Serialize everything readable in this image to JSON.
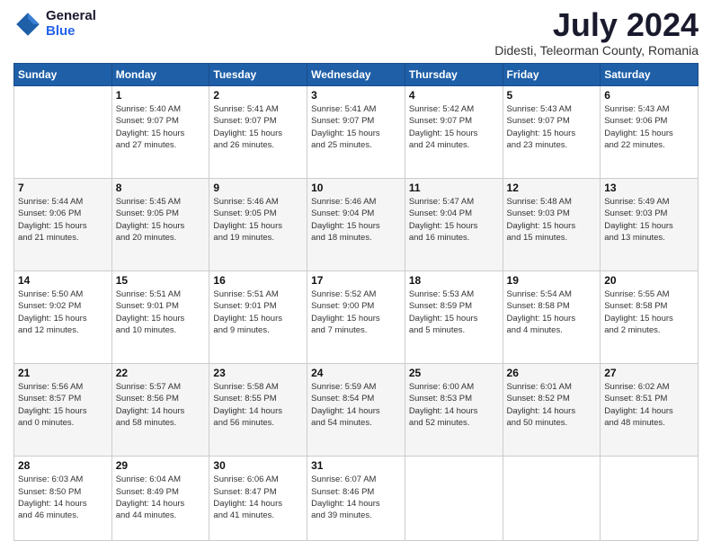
{
  "logo": {
    "general": "General",
    "blue": "Blue"
  },
  "title": "July 2024",
  "location": "Didesti, Teleorman County, Romania",
  "weekdays": [
    "Sunday",
    "Monday",
    "Tuesday",
    "Wednesday",
    "Thursday",
    "Friday",
    "Saturday"
  ],
  "weeks": [
    [
      {
        "day": "",
        "info": ""
      },
      {
        "day": "1",
        "info": "Sunrise: 5:40 AM\nSunset: 9:07 PM\nDaylight: 15 hours\nand 27 minutes."
      },
      {
        "day": "2",
        "info": "Sunrise: 5:41 AM\nSunset: 9:07 PM\nDaylight: 15 hours\nand 26 minutes."
      },
      {
        "day": "3",
        "info": "Sunrise: 5:41 AM\nSunset: 9:07 PM\nDaylight: 15 hours\nand 25 minutes."
      },
      {
        "day": "4",
        "info": "Sunrise: 5:42 AM\nSunset: 9:07 PM\nDaylight: 15 hours\nand 24 minutes."
      },
      {
        "day": "5",
        "info": "Sunrise: 5:43 AM\nSunset: 9:07 PM\nDaylight: 15 hours\nand 23 minutes."
      },
      {
        "day": "6",
        "info": "Sunrise: 5:43 AM\nSunset: 9:06 PM\nDaylight: 15 hours\nand 22 minutes."
      }
    ],
    [
      {
        "day": "7",
        "info": "Sunrise: 5:44 AM\nSunset: 9:06 PM\nDaylight: 15 hours\nand 21 minutes."
      },
      {
        "day": "8",
        "info": "Sunrise: 5:45 AM\nSunset: 9:05 PM\nDaylight: 15 hours\nand 20 minutes."
      },
      {
        "day": "9",
        "info": "Sunrise: 5:46 AM\nSunset: 9:05 PM\nDaylight: 15 hours\nand 19 minutes."
      },
      {
        "day": "10",
        "info": "Sunrise: 5:46 AM\nSunset: 9:04 PM\nDaylight: 15 hours\nand 18 minutes."
      },
      {
        "day": "11",
        "info": "Sunrise: 5:47 AM\nSunset: 9:04 PM\nDaylight: 15 hours\nand 16 minutes."
      },
      {
        "day": "12",
        "info": "Sunrise: 5:48 AM\nSunset: 9:03 PM\nDaylight: 15 hours\nand 15 minutes."
      },
      {
        "day": "13",
        "info": "Sunrise: 5:49 AM\nSunset: 9:03 PM\nDaylight: 15 hours\nand 13 minutes."
      }
    ],
    [
      {
        "day": "14",
        "info": "Sunrise: 5:50 AM\nSunset: 9:02 PM\nDaylight: 15 hours\nand 12 minutes."
      },
      {
        "day": "15",
        "info": "Sunrise: 5:51 AM\nSunset: 9:01 PM\nDaylight: 15 hours\nand 10 minutes."
      },
      {
        "day": "16",
        "info": "Sunrise: 5:51 AM\nSunset: 9:01 PM\nDaylight: 15 hours\nand 9 minutes."
      },
      {
        "day": "17",
        "info": "Sunrise: 5:52 AM\nSunset: 9:00 PM\nDaylight: 15 hours\nand 7 minutes."
      },
      {
        "day": "18",
        "info": "Sunrise: 5:53 AM\nSunset: 8:59 PM\nDaylight: 15 hours\nand 5 minutes."
      },
      {
        "day": "19",
        "info": "Sunrise: 5:54 AM\nSunset: 8:58 PM\nDaylight: 15 hours\nand 4 minutes."
      },
      {
        "day": "20",
        "info": "Sunrise: 5:55 AM\nSunset: 8:58 PM\nDaylight: 15 hours\nand 2 minutes."
      }
    ],
    [
      {
        "day": "21",
        "info": "Sunrise: 5:56 AM\nSunset: 8:57 PM\nDaylight: 15 hours\nand 0 minutes."
      },
      {
        "day": "22",
        "info": "Sunrise: 5:57 AM\nSunset: 8:56 PM\nDaylight: 14 hours\nand 58 minutes."
      },
      {
        "day": "23",
        "info": "Sunrise: 5:58 AM\nSunset: 8:55 PM\nDaylight: 14 hours\nand 56 minutes."
      },
      {
        "day": "24",
        "info": "Sunrise: 5:59 AM\nSunset: 8:54 PM\nDaylight: 14 hours\nand 54 minutes."
      },
      {
        "day": "25",
        "info": "Sunrise: 6:00 AM\nSunset: 8:53 PM\nDaylight: 14 hours\nand 52 minutes."
      },
      {
        "day": "26",
        "info": "Sunrise: 6:01 AM\nSunset: 8:52 PM\nDaylight: 14 hours\nand 50 minutes."
      },
      {
        "day": "27",
        "info": "Sunrise: 6:02 AM\nSunset: 8:51 PM\nDaylight: 14 hours\nand 48 minutes."
      }
    ],
    [
      {
        "day": "28",
        "info": "Sunrise: 6:03 AM\nSunset: 8:50 PM\nDaylight: 14 hours\nand 46 minutes."
      },
      {
        "day": "29",
        "info": "Sunrise: 6:04 AM\nSunset: 8:49 PM\nDaylight: 14 hours\nand 44 minutes."
      },
      {
        "day": "30",
        "info": "Sunrise: 6:06 AM\nSunset: 8:47 PM\nDaylight: 14 hours\nand 41 minutes."
      },
      {
        "day": "31",
        "info": "Sunrise: 6:07 AM\nSunset: 8:46 PM\nDaylight: 14 hours\nand 39 minutes."
      },
      {
        "day": "",
        "info": ""
      },
      {
        "day": "",
        "info": ""
      },
      {
        "day": "",
        "info": ""
      }
    ]
  ]
}
